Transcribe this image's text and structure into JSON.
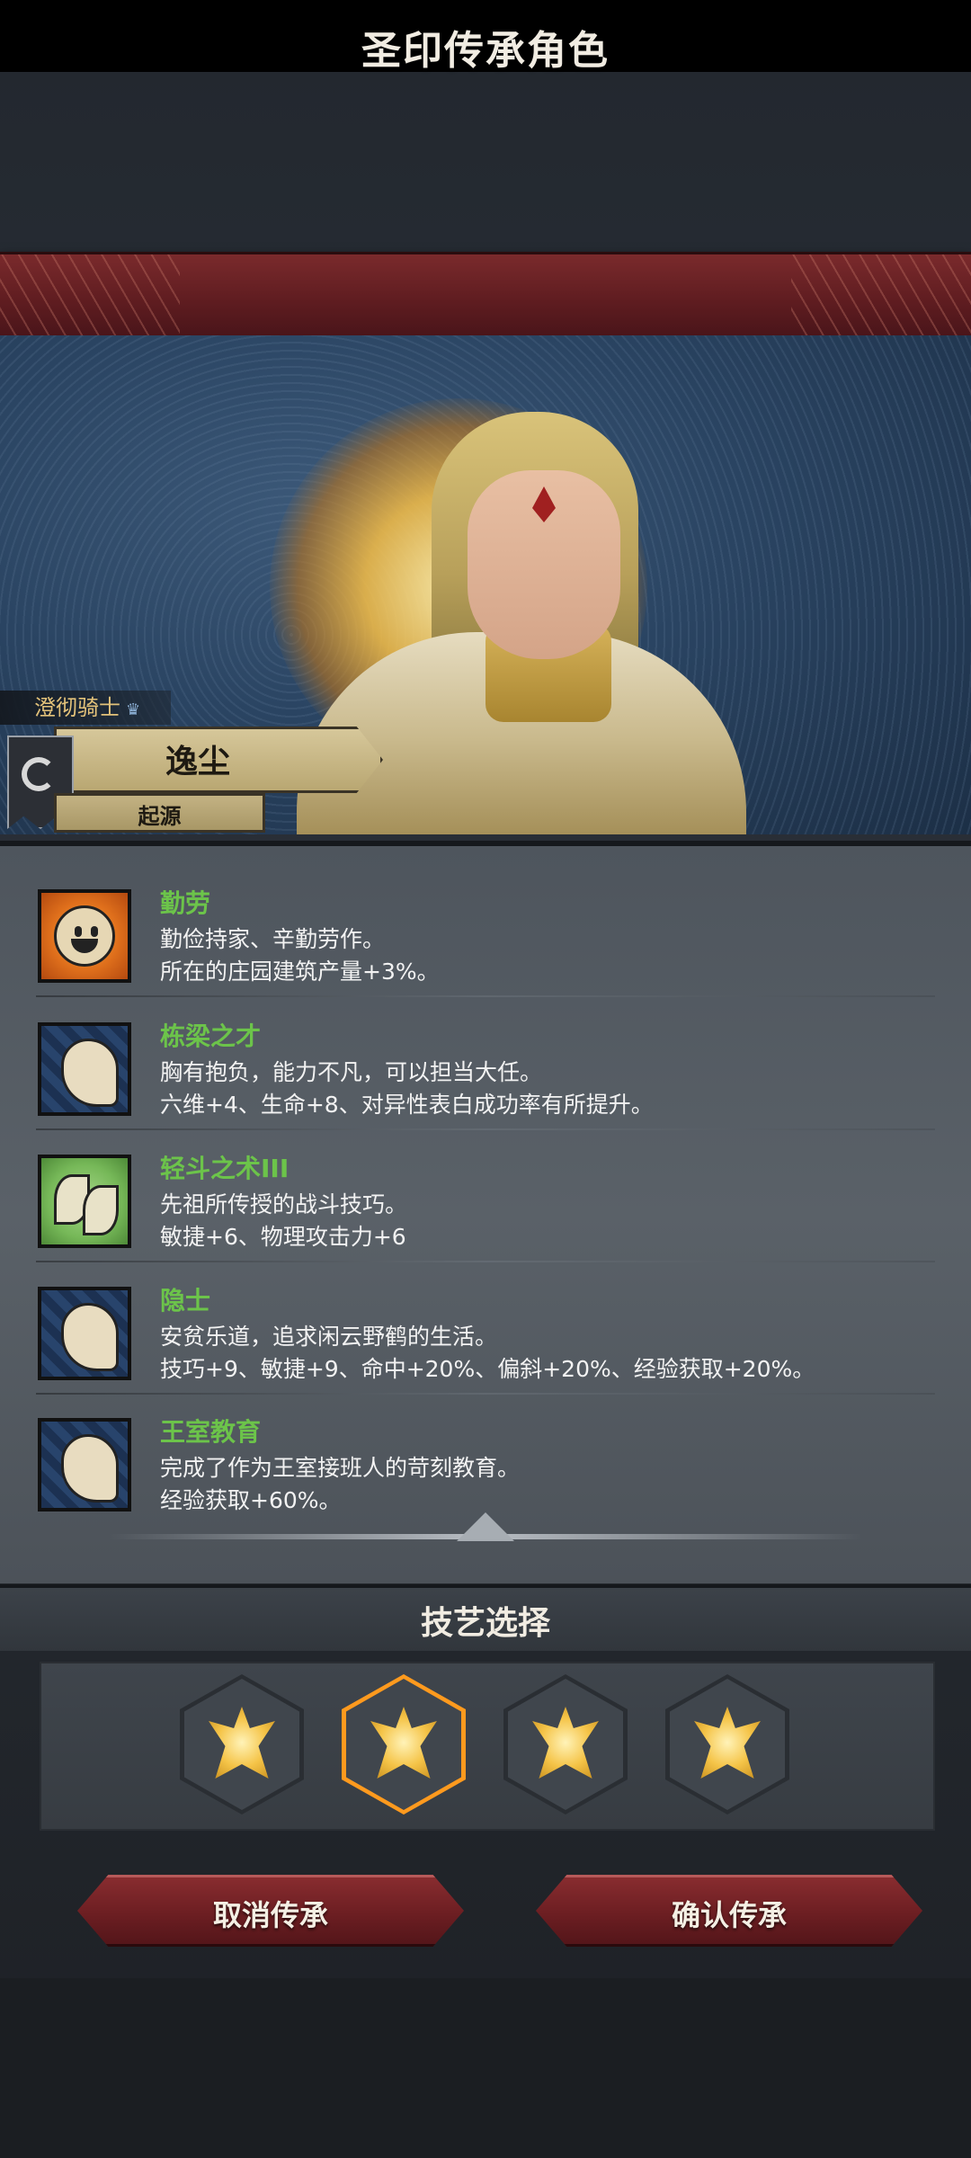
{
  "screen": {
    "title": "圣印传承角色"
  },
  "character": {
    "class_label": "澄彻骑士",
    "class_badge_icon": "crown-icon",
    "name": "逸尘",
    "origin_label": "起源",
    "banner_icon": "swirl-banner-icon"
  },
  "traits": [
    {
      "name": "勤劳",
      "line1": "勤俭持家、辛勤劳作。",
      "line2": "所在的庄园建筑产量+3%。",
      "icon": "smile-icon"
    },
    {
      "name": "栋梁之才",
      "line1": "胸有抱负，能力不凡，可以担当大任。",
      "line2": "六维+4、生命+8、对异性表白成功率有所提升。",
      "icon": "flexed-arm-icon"
    },
    {
      "name": "轻斗之术III",
      "line1": "先祖所传授的战斗技巧。",
      "line2": "敏捷+6、物理攻击力+6",
      "icon": "leaf-branch-icon"
    },
    {
      "name": "隐士",
      "line1": "安贫乐道，追求闲云野鹤的生活。",
      "line2": "技巧+9、敏捷+9、命中+20%、偏斜+20%、经验获取+20%。",
      "icon": "flexed-arm-icon"
    },
    {
      "name": "王室教育",
      "line1": "完成了作为王室接班人的苛刻教育。",
      "line2": "经验获取+60%。",
      "icon": "flexed-arm-icon"
    }
  ],
  "skill_selection": {
    "title": "技艺选择",
    "options": [
      {
        "icon": "holy-sigil-icon",
        "selected": false
      },
      {
        "icon": "holy-sigil-icon",
        "selected": true
      },
      {
        "icon": "holy-sigil-icon",
        "selected": false
      },
      {
        "icon": "holy-sigil-icon",
        "selected": false
      }
    ]
  },
  "buttons": {
    "cancel": "取消传承",
    "confirm": "确认传承"
  },
  "colors": {
    "trait_name": "#6cc44a",
    "title_banner": "#6e2226",
    "selected_glow": "#ff9a1e",
    "button": "#6c1e22"
  }
}
